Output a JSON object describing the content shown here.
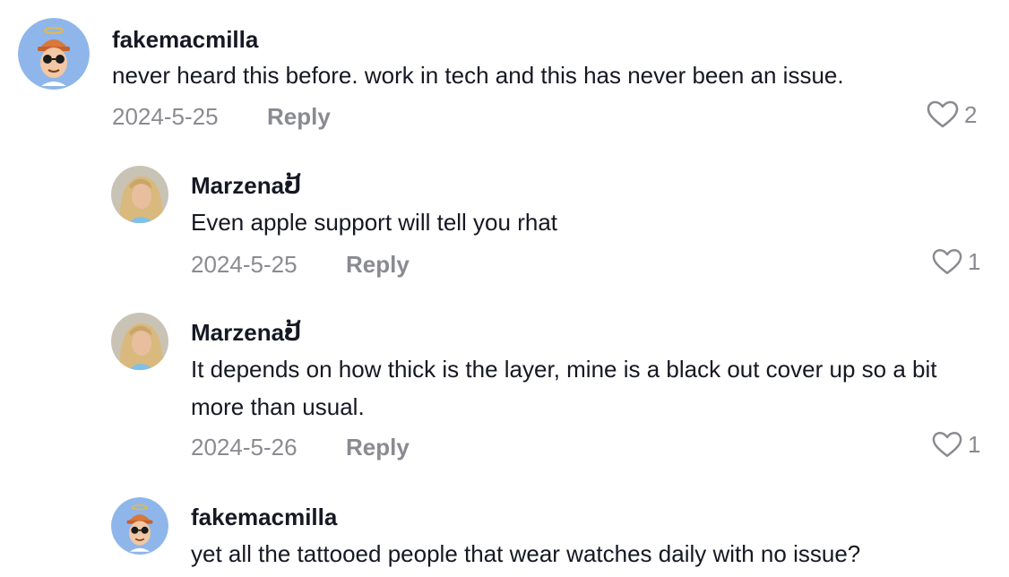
{
  "comments": [
    {
      "username": "fakemacmilla",
      "text": "never heard this before. work in tech and this has never been an issue.",
      "date": "2024-5-25",
      "reply_label": "Reply",
      "likes": "2",
      "avatar_icon": "cartoon-avatar-icon"
    },
    {
      "username": "Marzenaປ້",
      "text": "Even apple support will tell you rhat",
      "date": "2024-5-25",
      "reply_label": "Reply",
      "likes": "1",
      "avatar_icon": "photo-avatar-icon"
    },
    {
      "username": "Marzenaປ້",
      "text": "It depends on how thick is the layer, mine is a black out cover up so a bit more than usual.",
      "date": "2024-5-26",
      "reply_label": "Reply",
      "likes": "1",
      "avatar_icon": "photo-avatar-icon"
    },
    {
      "username": "fakemacmilla",
      "text": "yet all the tattooed people that wear watches daily with no issue?",
      "avatar_icon": "cartoon-avatar-icon"
    }
  ],
  "colors": {
    "primary_text": "#161823",
    "secondary_text": "#8a8b91",
    "avatar_bg_blue": "#8fb6ea"
  }
}
